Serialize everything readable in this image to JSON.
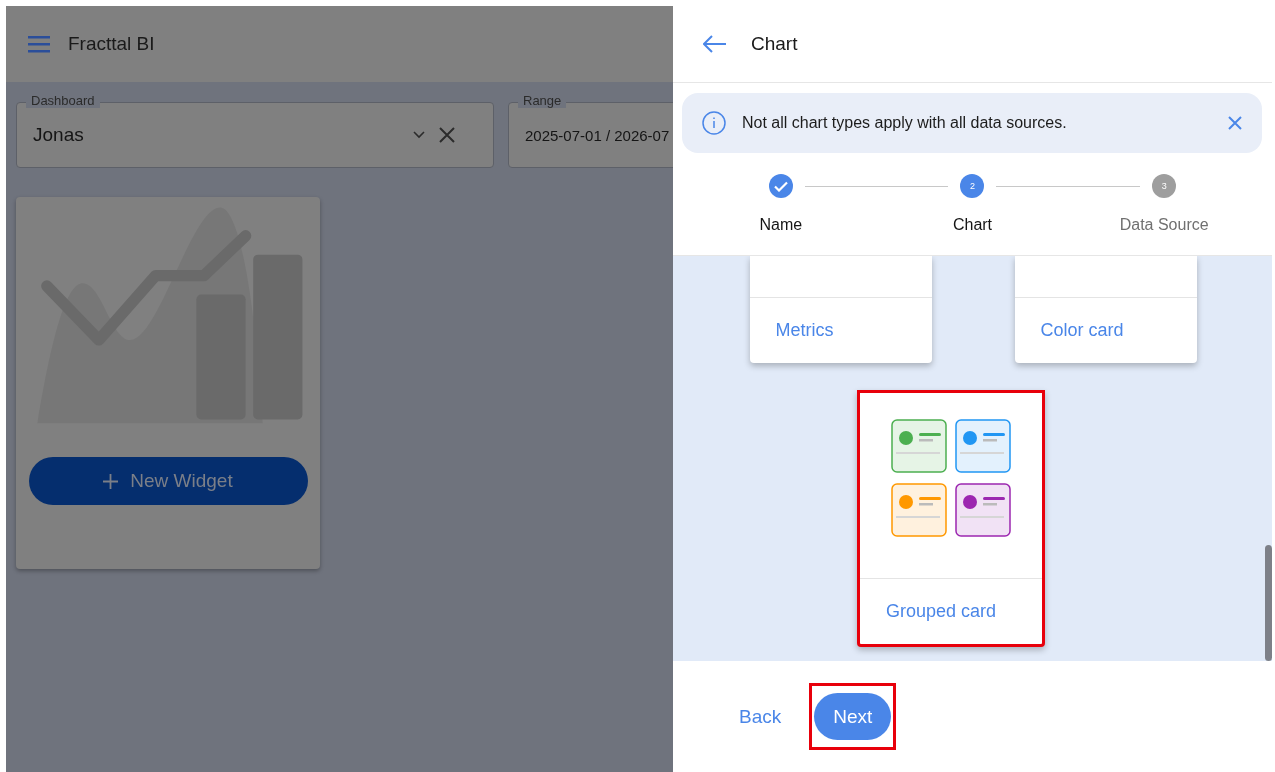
{
  "app_bar": {
    "title": "Fracttal BI"
  },
  "filters": [
    {
      "label": "Dashboard",
      "value": "Jonas",
      "kind": "select"
    },
    {
      "label": "Range",
      "value": "2025-07-01 / 2026-07",
      "kind": "date"
    }
  ],
  "widget_card": {
    "button": "New Widget"
  },
  "drawer": {
    "title": "Chart",
    "alert": {
      "text": "Not all chart types apply with all data sources."
    },
    "steps": [
      {
        "label": "Name",
        "kind": "done"
      },
      {
        "label": "Chart",
        "number": "2",
        "kind": "active"
      },
      {
        "label": "Data Source",
        "number": "3",
        "kind": "pending"
      }
    ],
    "chart_types": [
      {
        "label": "Metrics",
        "kind": "cut",
        "highlighted": false
      },
      {
        "label": "Color card",
        "kind": "cut",
        "highlighted": false
      },
      {
        "label": "Grouped card",
        "kind": "grouped",
        "highlighted": true
      }
    ],
    "footer": {
      "back": "Back",
      "next": "Next",
      "next_highlighted": true
    }
  }
}
